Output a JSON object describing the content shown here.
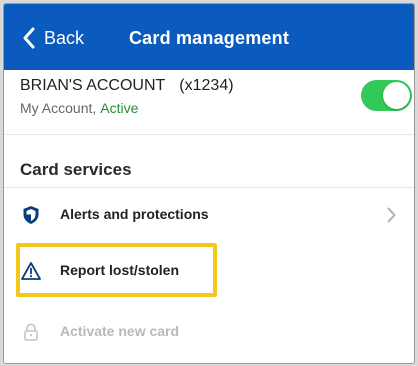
{
  "header": {
    "back_label": "Back",
    "title": "Card management",
    "background_color": "#0b5bbf"
  },
  "account": {
    "name": "BRIAN'S ACCOUNT",
    "masked_number": "(x1234)",
    "type": "My Account,",
    "status": "Active",
    "toggle_on": true,
    "toggle_color": "#34c759"
  },
  "card_services": {
    "title": "Card services",
    "items": [
      {
        "label": "Alerts and protections",
        "icon": "shield-icon",
        "chevron": true,
        "enabled": true
      },
      {
        "label": "Report lost/stolen",
        "icon": "warning-triangle-icon",
        "chevron": false,
        "enabled": true,
        "highlighted": true
      },
      {
        "label": "Activate new card",
        "icon": "lock-icon",
        "chevron": false,
        "enabled": false
      }
    ]
  },
  "highlight_color": "#f3c81c"
}
